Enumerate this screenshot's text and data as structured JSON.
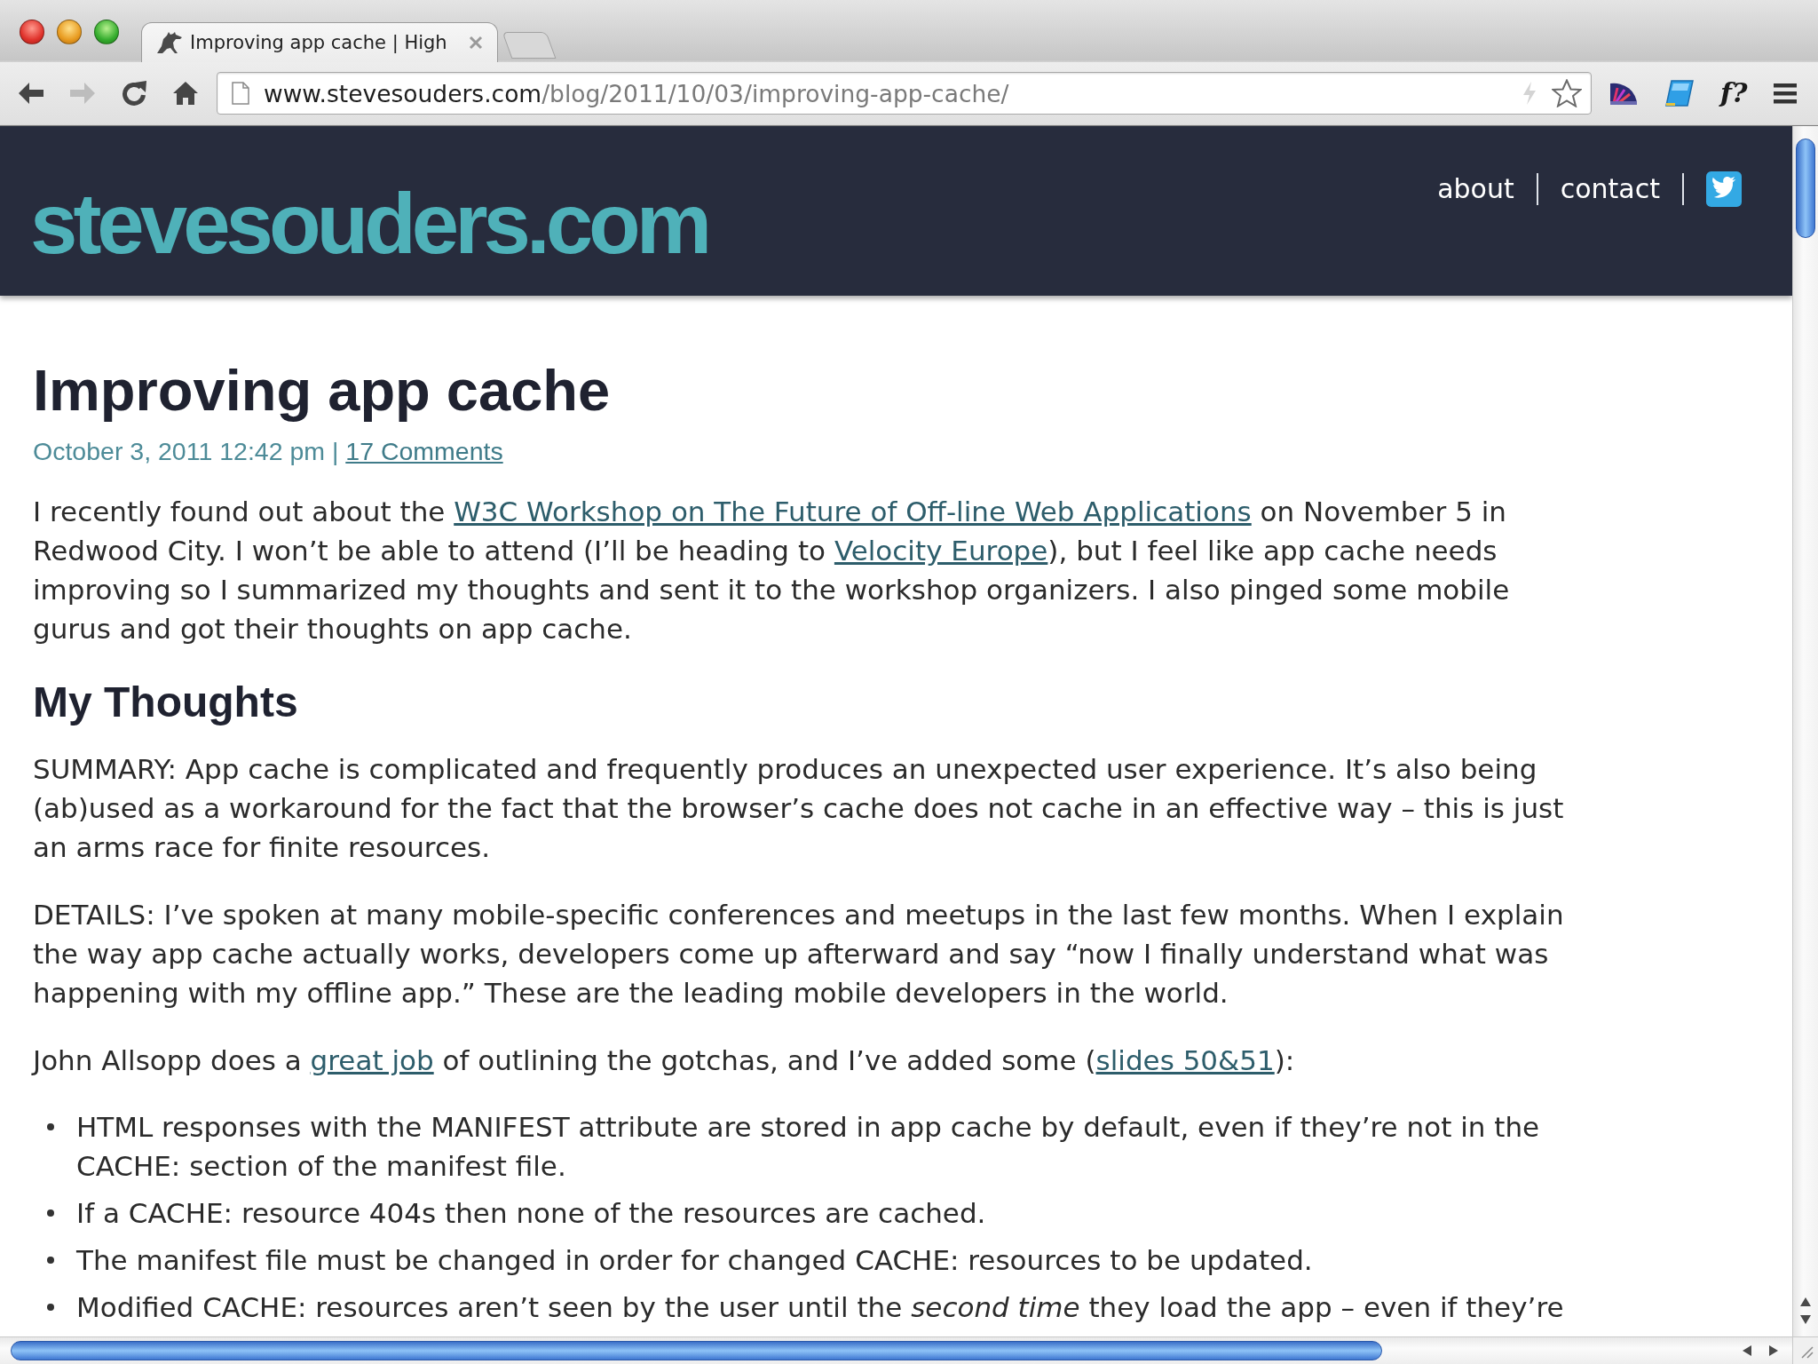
{
  "browser": {
    "tabs": [
      {
        "title": "Improving app cache | High",
        "selected": true
      }
    ],
    "nav_buttons": [
      {
        "kind": "back",
        "disabled": false
      },
      {
        "kind": "forward",
        "disabled": true
      },
      {
        "kind": "reload",
        "disabled": false
      },
      {
        "kind": "home",
        "disabled": false
      }
    ],
    "address_bar": {
      "host": "www.stevesouders.com",
      "path": "/blog/2011/10/03/improving-app-cache/"
    },
    "extensions": [
      {
        "kind": "gauge"
      },
      {
        "kind": "tile"
      },
      {
        "kind": "text",
        "label": "f?"
      }
    ]
  },
  "site_header": {
    "logo": "stevesouders.com",
    "nav": [
      "about",
      "contact"
    ]
  },
  "post": {
    "title": "Improving app cache",
    "meta": {
      "date": "October 3, 2011 12:42 pm",
      "separator": "|",
      "comments_link": "17 Comments"
    },
    "blocks": [
      {
        "kind": "paragraph",
        "segments": [
          {
            "kind": "text",
            "text": "I recently found out about the "
          },
          {
            "kind": "link",
            "text": "W3C Workshop on The Future of Off-line Web Applications"
          },
          {
            "kind": "text",
            "text": " on November 5 in Redwood City. I won’t be able to attend (I’ll be heading to "
          },
          {
            "kind": "link",
            "text": "Velocity Europe"
          },
          {
            "kind": "text",
            "text": "), but I feel like app cache needs improving so I summarized my thoughts and sent it to the workshop organizers. I also pinged some mobile gurus and got their thoughts on app cache."
          }
        ]
      },
      {
        "kind": "heading",
        "text": "My Thoughts"
      },
      {
        "kind": "paragraph",
        "segments": [
          {
            "kind": "text",
            "text": "SUMMARY: App cache is complicated and frequently produces an unexpected user experience. It’s also being (ab)used as a workaround for the fact that the browser’s cache does not cache in an effective way – this is just an arms race for finite resources."
          }
        ]
      },
      {
        "kind": "paragraph",
        "segments": [
          {
            "kind": "text",
            "text": "DETAILS: I’ve spoken at many mobile-specific conferences and meetups in the last few months. When I explain the way app cache actually works, developers come up afterward and say “now I finally understand what was happening with my offline app.” These are the leading mobile developers in the world."
          }
        ]
      },
      {
        "kind": "paragraph",
        "segments": [
          {
            "kind": "text",
            "text": "John Allsopp does a "
          },
          {
            "kind": "link",
            "text": "great job"
          },
          {
            "kind": "text",
            "text": " of outlining the gotchas, and I’ve added some ("
          },
          {
            "kind": "link",
            "text": "slides 50&51"
          },
          {
            "kind": "text",
            "text": "):"
          }
        ]
      },
      {
        "kind": "bullets",
        "items": [
          "HTML responses with the MANIFEST attribute are stored in app cache by default, even if they’re not in the CACHE: section of the manifest file.",
          "If a CACHE: resource 404s then none of the resources are cached.",
          "The manifest file must be changed in order for changed CACHE: resources to be updated.",
          "Modified CACHE: resources aren’t seen by the user until the *second time* they load the app – even if they’re"
        ]
      }
    ]
  }
}
